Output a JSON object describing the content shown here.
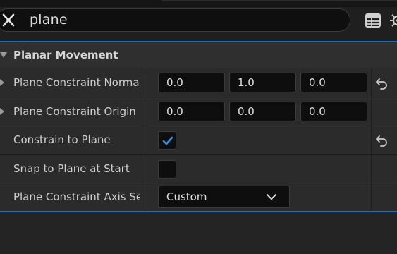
{
  "search": {
    "query": "plane"
  },
  "category": {
    "label": "Planar Movement"
  },
  "rows": [
    {
      "label": "Plane Constraint Normal",
      "values": [
        "0.0",
        "1.0",
        "0.0"
      ]
    },
    {
      "label": "Plane Constraint Origin",
      "values": [
        "0.0",
        "0.0",
        "0.0"
      ]
    },
    {
      "label": "Constrain to Plane",
      "checked": true
    },
    {
      "label": "Snap to Plane at Start",
      "checked": false
    },
    {
      "label": "Plane Constraint Axis Se...",
      "selected": "Custom"
    }
  ],
  "icons": {
    "clear": "close-icon",
    "table": "table-view-icon",
    "settings": "gear-icon",
    "reset": "reset-arrow-icon",
    "check": "check-icon",
    "dropdown": "chevron-down-icon"
  },
  "colors": {
    "accent": "#1c6cc4",
    "check": "#3b8fe6"
  }
}
